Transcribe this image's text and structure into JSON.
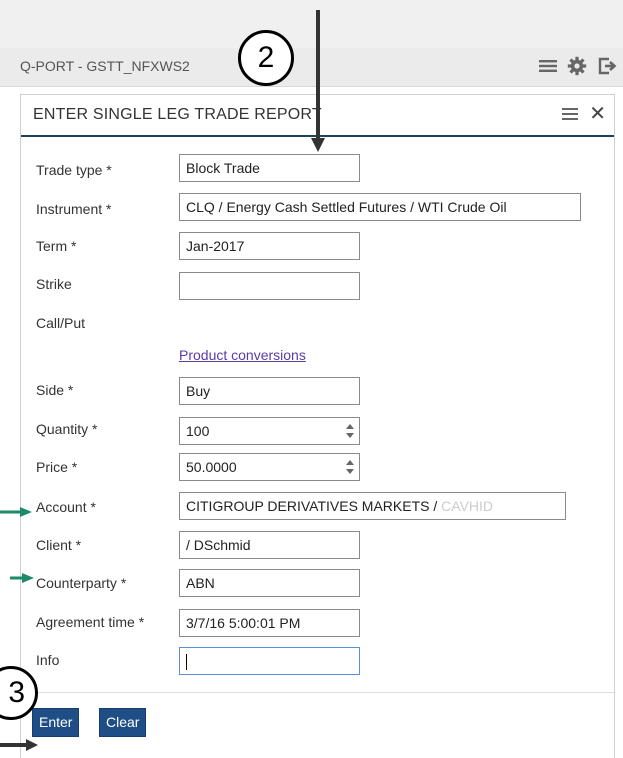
{
  "app": {
    "title": "Q-PORT - GSTT_NFXWS2",
    "icons": [
      "menu-icon",
      "gear-icon",
      "logout-icon"
    ]
  },
  "panel": {
    "title": "ENTER SINGLE LEG TRADE REPORT",
    "close_glyph": "✕",
    "fields": {
      "trade_type": {
        "label": "Trade type *",
        "value": "Block Trade"
      },
      "instrument": {
        "label": "Instrument *",
        "value": "CLQ / Energy Cash Settled Futures / WTI Crude Oil"
      },
      "term": {
        "label": "Term *",
        "value": "Jan-2017"
      },
      "strike": {
        "label": "Strike",
        "value": ""
      },
      "call_put": {
        "label": "Call/Put"
      },
      "side": {
        "label": "Side *",
        "value": "Buy"
      },
      "quantity": {
        "label": "Quantity *",
        "value": "100"
      },
      "price": {
        "label": "Price *",
        "value": "50.0000"
      },
      "account": {
        "label": "Account *",
        "value": "CITIGROUP DERIVATIVES MARKETS /",
        "faded_suffix": "CAVHID"
      },
      "client": {
        "label": "Client *",
        "value": "/ DSchmid"
      },
      "counterparty": {
        "label": "Counterparty *",
        "value": "ABN"
      },
      "agreement_time": {
        "label": "Agreement time *",
        "value": "3/7/16 5:00:01 PM"
      },
      "info": {
        "label": "Info",
        "value": ""
      }
    },
    "product_conversions": "Product conversions",
    "buttons": {
      "enter": "Enter",
      "clear": "Clear"
    }
  },
  "annotations": {
    "marker_2": "2",
    "marker_3": "3"
  },
  "colors": {
    "header_underline": "#1f3f63",
    "button": "#1f4e86",
    "annotation_arrow_green": "#1e8a6a",
    "link": "#5a3ba8"
  }
}
